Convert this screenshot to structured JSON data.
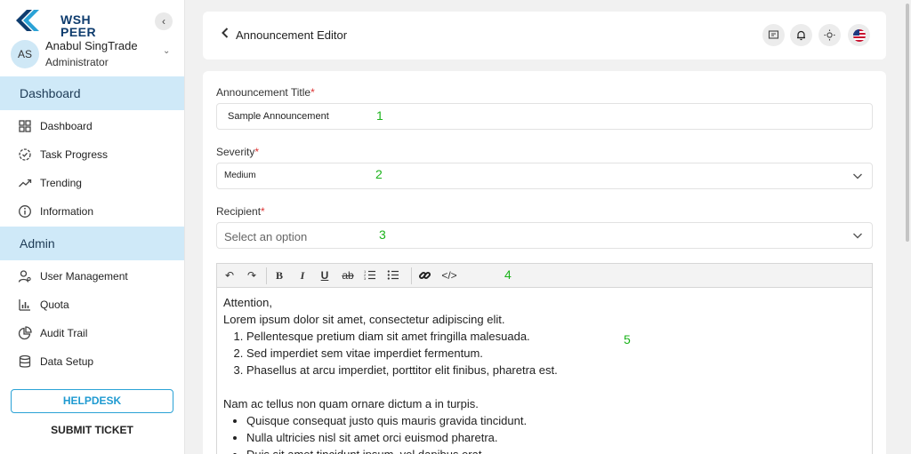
{
  "brand": {
    "logo_line1": "WSH",
    "logo_line2": "PEER"
  },
  "user": {
    "initials": "AS",
    "name": "Anabul SingTrade",
    "role": "Administrator"
  },
  "sidebar": {
    "sections": [
      {
        "label": "Dashboard",
        "items": [
          "Dashboard",
          "Task Progress",
          "Trending",
          "Information"
        ]
      },
      {
        "label": "Admin",
        "items": [
          "User Management",
          "Quota",
          "Audit Trail",
          "Data Setup"
        ]
      }
    ],
    "helpdesk_label": "HELPDESK",
    "submit_ticket_label": "SUBMIT TICKET"
  },
  "header": {
    "title": "Announcement Editor"
  },
  "form": {
    "title_label": "Announcement Title",
    "title_value": "Sample Announcement",
    "severity_label": "Severity",
    "severity_value": "Medium",
    "recipient_label": "Recipient",
    "recipient_placeholder": "Select an option",
    "required_mark": "*"
  },
  "markers": [
    "1",
    "2",
    "3",
    "4",
    "5"
  ],
  "editor": {
    "toolbar": {
      "bold": "B",
      "italic": "I",
      "underline": "U",
      "strike": "ab",
      "code": "</>"
    },
    "greeting": "Attention,",
    "paragraph1": "Lorem ipsum dolor sit amet, consectetur adipiscing elit.",
    "ordered": [
      "Pellentesque pretium diam sit amet fringilla malesuada.",
      "Sed imperdiet sem vitae imperdiet fermentum.",
      "Phasellus at arcu imperdiet, porttitor elit finibus, pharetra est."
    ],
    "paragraph2": "Nam ac tellus non quam ornare dictum a in turpis.",
    "unordered": [
      "Quisque consequat justo quis mauris gravida tincidunt.",
      "Nulla ultricies nisl sit amet orci euismod pharetra.",
      "Duis sit amet tincidunt ipsum, vel dapibus erat."
    ]
  },
  "colors": {
    "accent": "#1f9ad1",
    "section_bg": "#cfe9f8",
    "marker": "#1bb31b",
    "required": "#d33"
  }
}
